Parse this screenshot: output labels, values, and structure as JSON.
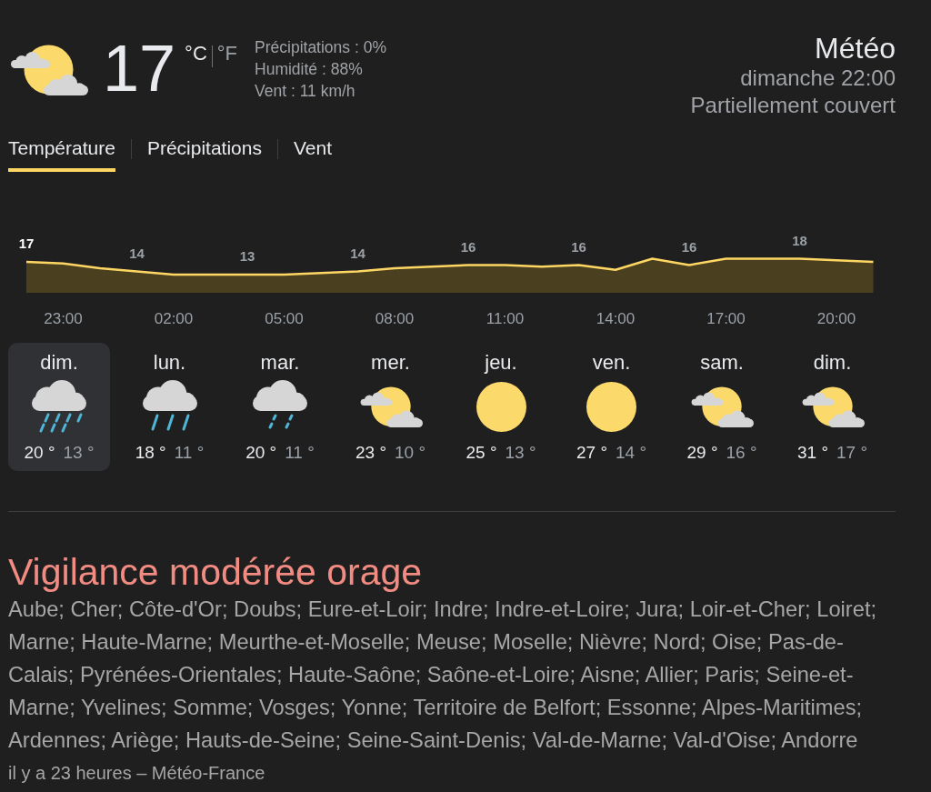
{
  "current": {
    "kind": "partly_cloudy",
    "temperature": "17",
    "units": [
      {
        "label": "°C",
        "selected": true
      },
      {
        "label": "°F",
        "selected": false
      }
    ],
    "details": [
      "Précipitations : 0%",
      "Humidité : 88%",
      "Vent : 11 km/h"
    ]
  },
  "header": {
    "title": "Météo",
    "time": "dimanche 22:00",
    "description": "Partiellement couvert"
  },
  "tabs": [
    {
      "label": "Température",
      "selected": true
    },
    {
      "label": "Précipitations",
      "selected": false
    },
    {
      "label": "Vent",
      "selected": false
    }
  ],
  "chart": {
    "chart_data": {
      "type": "area",
      "categories": [
        null,
        "23:00",
        null,
        null,
        "02:00",
        null,
        null,
        "05:00",
        null,
        null,
        "08:00",
        null,
        null,
        "11:00",
        null,
        null,
        "14:00",
        null,
        null,
        "17:00",
        null,
        null,
        "20:00",
        null
      ],
      "values": [
        17,
        16.5,
        15,
        14,
        13,
        13,
        13,
        13,
        13.5,
        14,
        15,
        15.5,
        16,
        16,
        15.5,
        16,
        14.5,
        18,
        16,
        18,
        18,
        18,
        17.5,
        17
      ],
      "value_labels": [
        "17",
        null,
        null,
        "14",
        null,
        null,
        "13",
        null,
        null,
        "14",
        null,
        null,
        "16",
        null,
        null,
        "16",
        null,
        null,
        "16",
        null,
        null,
        "18",
        null,
        null
      ]
    },
    "label_states": [
      {
        "current": true
      },
      {
        "current": false
      },
      {
        "current": false
      },
      {
        "current": false
      },
      {
        "current": false
      },
      {
        "current": false
      },
      {
        "current": false
      },
      {
        "current": false
      }
    ]
  },
  "forecast": [
    {
      "day": "dim.",
      "kind": "heavy_rain",
      "high": "20 °",
      "low": "13 °",
      "selected": true
    },
    {
      "day": "lun.",
      "kind": "rain",
      "high": "18 °",
      "low": "11 °",
      "selected": false
    },
    {
      "day": "mar.",
      "kind": "light_rain",
      "high": "20 °",
      "low": "11 °",
      "selected": false
    },
    {
      "day": "mer.",
      "kind": "partly_cloudy",
      "high": "23 °",
      "low": "10 °",
      "selected": false
    },
    {
      "day": "jeu.",
      "kind": "sunny",
      "high": "25 °",
      "low": "13 °",
      "selected": false
    },
    {
      "day": "ven.",
      "kind": "sunny",
      "high": "27 °",
      "low": "14 °",
      "selected": false
    },
    {
      "day": "sam.",
      "kind": "partly_cloudy",
      "high": "29 °",
      "low": "16 °",
      "selected": false
    },
    {
      "day": "dim.",
      "kind": "partly_cloudy",
      "high": "31 °",
      "low": "17 °",
      "selected": false
    }
  ],
  "alert": {
    "title": "Vigilance modérée orage",
    "areas": "Aube; Cher; Côte-d'Or; Doubs; Eure-et-Loir; Indre; Indre-et-Loire; Jura; Loir-et-Cher; Loiret; Marne; Haute-Marne; Meurthe-et-Moselle; Meuse; Moselle; Nièvre; Nord; Oise; Pas-de-Calais; Pyrénées-Orientales; Haute-Saône; Saône-et-Loire; Aisne; Allier; Paris; Seine-et-Marne; Yvelines; Somme; Vosges; Yonne; Territoire de Belfort; Essonne; Alpes-Maritimes; Ardennes; Ariège; Hauts-de-Seine; Seine-Saint-Denis; Val-de-Marne; Val-d'Oise; Andorre",
    "source": "il y a 23 heures – Météo-France"
  }
}
